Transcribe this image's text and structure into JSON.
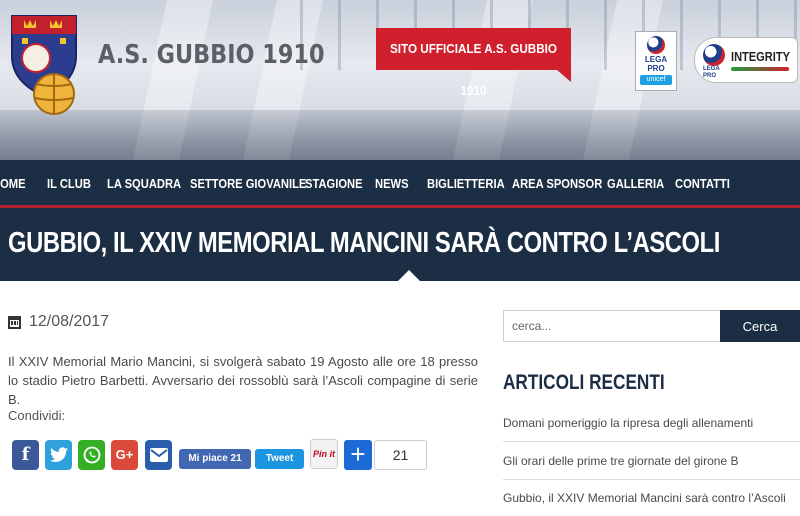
{
  "header": {
    "site_name": "A.S. GUBBIO 1910",
    "official_label": "SITO UFFICIALE A.S. GUBBIO 1910",
    "legapro_logo": {
      "line1": "LEGA",
      "line2": "PRO",
      "line3": "unicef"
    },
    "integrity_logo": {
      "word": "INTEGRITY",
      "line1": "LEGA",
      "line2": "PRO"
    }
  },
  "nav": {
    "items": [
      "HOME",
      "IL CLUB",
      "LA SQUADRA",
      "SETTORE GIOVANILE",
      "STAGIONE",
      "NEWS",
      "BIGLIETTERIA",
      "AREA SPONSOR",
      "GALLERIA",
      "CONTATTI"
    ]
  },
  "article": {
    "title": "GUBBIO, IL XXIV MEMORIAL MANCINI SARÀ CONTRO L’ASCOLI",
    "date": "12/08/2017",
    "body": "Il XXIV Memorial Mario Mancini, si svolgerà sabato 19 Agosto alle ore 18 presso lo stadio Pietro Barbetti. Avversario dei rossoblù sarà l’Ascoli compagine di serie B.",
    "share_label": "Condividi:",
    "share": {
      "facebook": "f",
      "google_plus": "G+",
      "like_label": "Mi piace 21",
      "tweet_label": "Tweet",
      "pinit_label": "Pin it",
      "share_count": "21"
    }
  },
  "sidebar": {
    "search_placeholder": "cerca...",
    "search_button": "Cerca",
    "recent_title": "ARTICOLI RECENTI",
    "recent": [
      "Domani pomeriggio la ripresa degli allenamenti",
      "Gli orari delle prime tre giornate del girone B",
      "Gubbio, il XXIV Memorial Mancini sarà contro l’Ascoli"
    ]
  },
  "colors": {
    "navy": "#1b2e43",
    "brand_red": "#d0202e",
    "accent_red_line": "#b3202a"
  },
  "icons": [
    "calendar-icon",
    "facebook-icon",
    "twitter-icon",
    "whatsapp-icon",
    "google-plus-icon",
    "mail-icon",
    "plus-icon"
  ]
}
